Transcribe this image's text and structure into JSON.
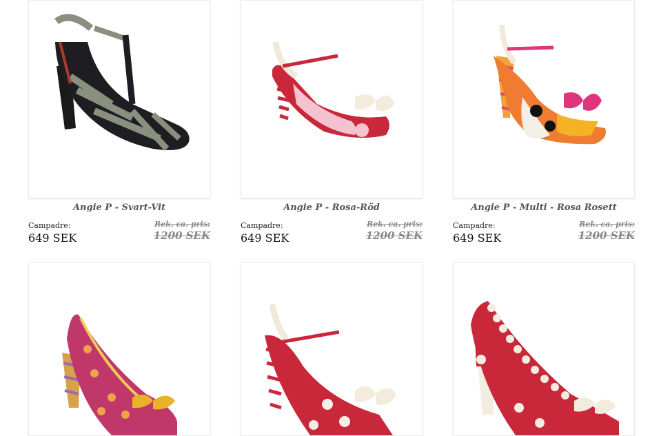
{
  "products": [
    {
      "name": "Angie P - Svart-Vit",
      "price_label": "Campadre:",
      "price": "649 SEK",
      "rek_label": "Rek. ca. pris:",
      "rek_price": "1200 SEK",
      "image": "black-grey-striped-t-bar-pump"
    },
    {
      "name": "Angie P - Rosa-Röd",
      "price_label": "Campadre:",
      "price": "649 SEK",
      "rek_label": "Rek. ca. pris:",
      "rek_price": "1200 SEK",
      "image": "pink-red-bow-sandal"
    },
    {
      "name": "Angie P - Multi - Rosa Rosett",
      "price_label": "Campadre:",
      "price": "649 SEK",
      "rek_label": "Rek. ca. pris:",
      "rek_price": "1200 SEK",
      "image": "multicolor-polka-dot-bow-sandal"
    },
    {
      "name": "",
      "image": "pink-suede-polka-dot-pump"
    },
    {
      "name": "",
      "image": "red-polka-dot-bow-sandal"
    },
    {
      "name": "",
      "image": "red-white-scalloped-pump"
    }
  ]
}
